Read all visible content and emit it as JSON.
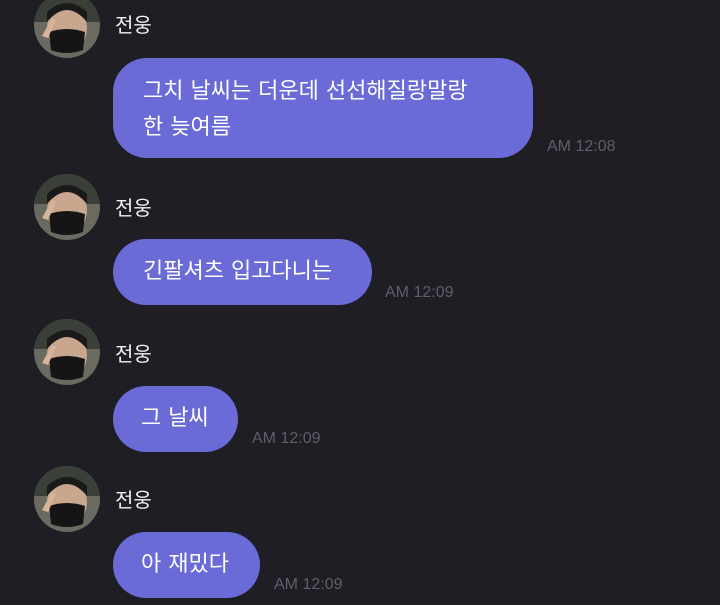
{
  "messages": [
    {
      "sender": "전웅",
      "lines": [
        "그치 날씨는 더운데 선선해질랑말랑",
        "한 늦여름"
      ],
      "time": "AM 12:08"
    },
    {
      "sender": "전웅",
      "lines": [
        "긴팔셔츠 입고다니는"
      ],
      "time": "AM 12:09"
    },
    {
      "sender": "전웅",
      "lines": [
        "그 날씨"
      ],
      "time": "AM 12:09"
    },
    {
      "sender": "전웅",
      "lines": [
        "아 재밌다"
      ],
      "time": "AM 12:09"
    }
  ],
  "colors": {
    "background": "#1e1e24",
    "bubble": "#6a6bd6",
    "bubble_text": "#ffffff",
    "sender_text": "#f2f2f4",
    "time_text": "#5e5f6a"
  }
}
